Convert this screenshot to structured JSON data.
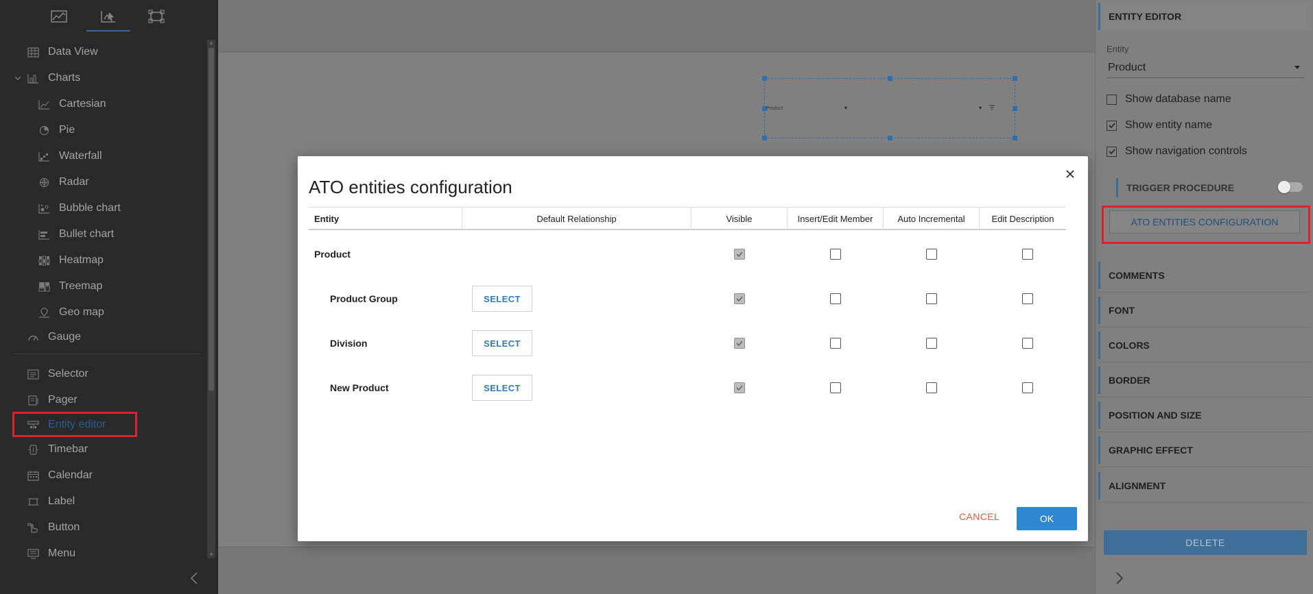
{
  "sidebar": {
    "items": [
      {
        "label": "Data View"
      },
      {
        "label": "Charts"
      },
      {
        "label": "Cartesian"
      },
      {
        "label": "Pie"
      },
      {
        "label": "Waterfall"
      },
      {
        "label": "Radar"
      },
      {
        "label": "Bubble chart"
      },
      {
        "label": "Bullet chart"
      },
      {
        "label": "Heatmap"
      },
      {
        "label": "Treemap"
      },
      {
        "label": "Geo map"
      },
      {
        "label": "Gauge"
      },
      {
        "label": "Selector"
      },
      {
        "label": "Pager"
      },
      {
        "label": "Entity editor"
      },
      {
        "label": "Timebar"
      },
      {
        "label": "Calendar"
      },
      {
        "label": "Label"
      },
      {
        "label": "Button"
      },
      {
        "label": "Menu"
      }
    ]
  },
  "canvas": {
    "widget_entity_text": "Product"
  },
  "right_panel": {
    "title": "ENTITY EDITOR",
    "entity_label": "Entity",
    "entity_value": "Product",
    "checks": [
      {
        "label": "Show database name",
        "checked": false
      },
      {
        "label": "Show entity name",
        "checked": true
      },
      {
        "label": "Show navigation controls",
        "checked": true
      }
    ],
    "trigger_label": "TRIGGER PROCEDURE",
    "ato_button": "ATO ENTITIES CONFIGURATION",
    "sections": [
      "COMMENTS",
      "FONT",
      "COLORS",
      "BORDER",
      "POSITION AND SIZE",
      "GRAPHIC EFFECT",
      "ALIGNMENT"
    ],
    "delete_button": "DELETE"
  },
  "modal": {
    "title": "ATO entities configuration",
    "columns": [
      "Entity",
      "Default Relationship",
      "Visible",
      "Insert/Edit Member",
      "Auto Incremental",
      "Edit Description"
    ],
    "rows": [
      {
        "entity": "Product",
        "select": "",
        "visible": true,
        "insert": false,
        "auto": false,
        "desc": false
      },
      {
        "entity": "Product Group",
        "select": "SELECT",
        "visible": true,
        "insert": false,
        "auto": false,
        "desc": false
      },
      {
        "entity": "Division",
        "select": "SELECT",
        "visible": true,
        "insert": false,
        "auto": false,
        "desc": false
      },
      {
        "entity": "New Product",
        "select": "SELECT",
        "visible": true,
        "insert": false,
        "auto": false,
        "desc": false
      }
    ],
    "cancel_label": "CANCEL",
    "ok_label": "OK"
  },
  "colors": {
    "accent": "#2f88cf",
    "highlight_red": "#e0202a",
    "cancel_red": "#e05a43"
  }
}
